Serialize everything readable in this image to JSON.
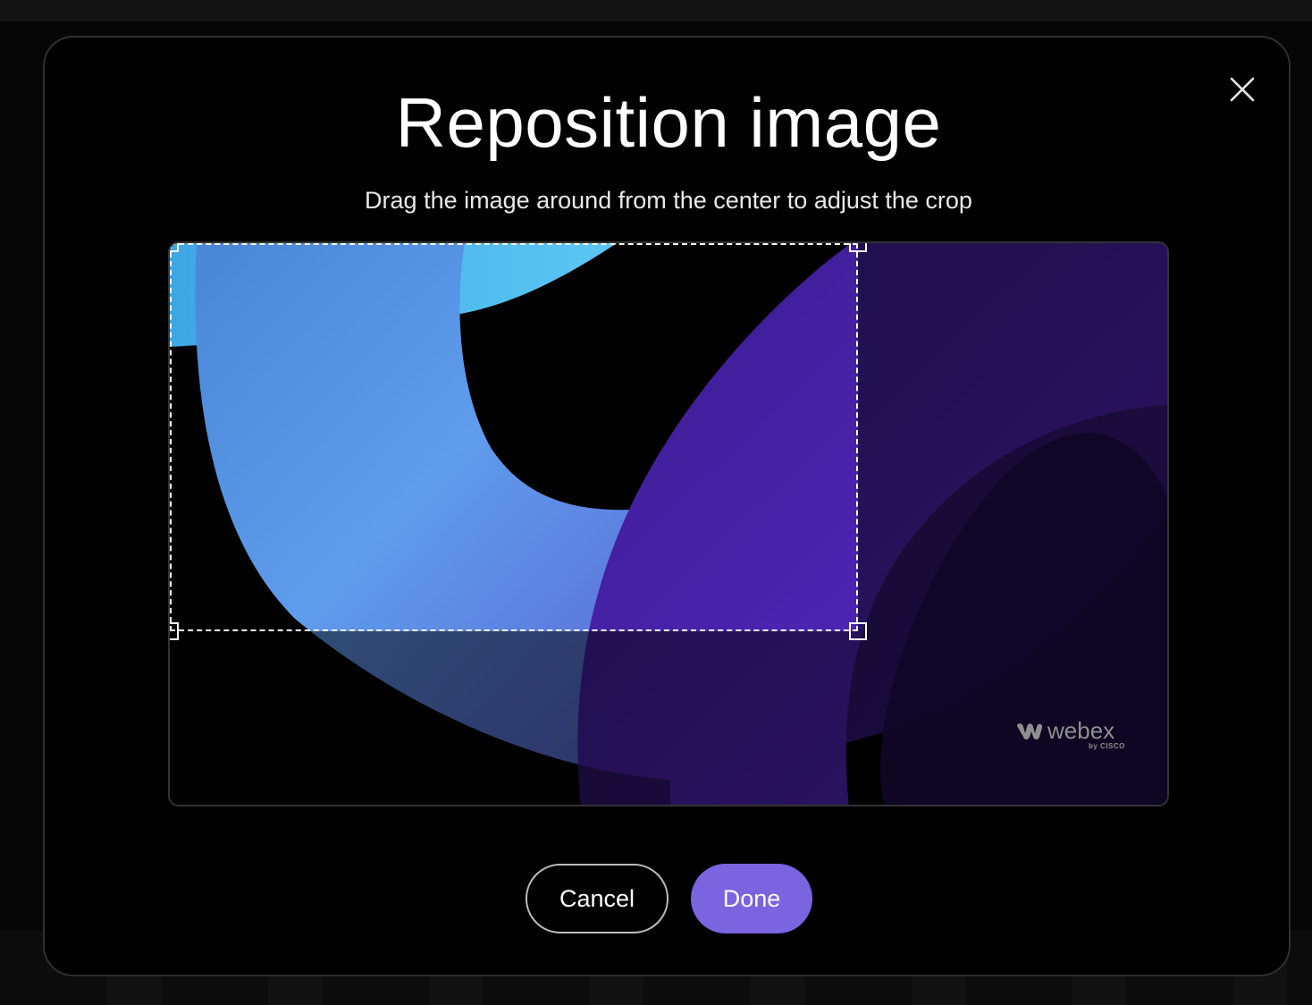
{
  "modal": {
    "title": "Reposition image",
    "subtitle": "Drag the image around from the center to adjust the crop",
    "close_icon": "close-icon"
  },
  "image": {
    "brand_logo_text": "webex",
    "brand_logo_sub": "by CISCO"
  },
  "actions": {
    "cancel_label": "Cancel",
    "done_label": "Done"
  },
  "colors": {
    "modal_bg": "#000000",
    "done_button": "#7a64e0",
    "cancel_border": "#bdbdbd"
  }
}
